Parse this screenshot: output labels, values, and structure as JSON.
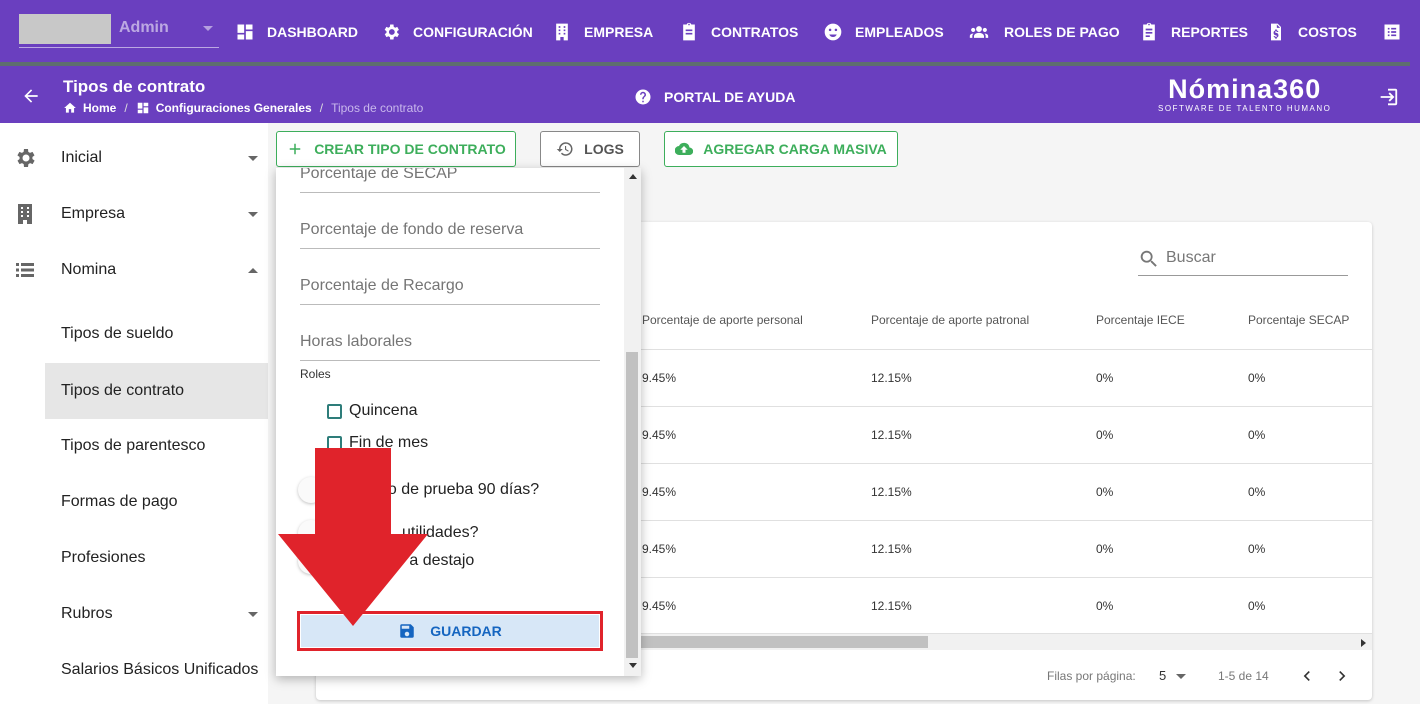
{
  "topnav": {
    "user": "Admin",
    "items": [
      {
        "label": "DASHBOARD",
        "icon": "dashboard-icon"
      },
      {
        "label": "CONFIGURACIÓN",
        "icon": "gear-icon"
      },
      {
        "label": "EMPRESA",
        "icon": "building-icon"
      },
      {
        "label": "CONTRATOS",
        "icon": "clipboard-icon"
      },
      {
        "label": "EMPLEADOS",
        "icon": "face-icon"
      },
      {
        "label": "ROLES DE PAGO",
        "icon": "group-icon"
      },
      {
        "label": "REPORTES",
        "icon": "clipboard-list-icon"
      },
      {
        "label": "COSTOS",
        "icon": "file-dollar-icon"
      }
    ]
  },
  "header": {
    "title": "Tipos de contrato",
    "breadcrumb": [
      "Home",
      "Configuraciones Generales",
      "Tipos de contrato"
    ],
    "help": "PORTAL DE AYUDA",
    "brand": "Nómina360",
    "brand_sub": "SOFTWARE DE TALENTO HUMANO"
  },
  "sidebar": {
    "items": [
      {
        "label": "Inicial"
      },
      {
        "label": "Empresa"
      },
      {
        "label": "Nomina"
      }
    ],
    "subitems": [
      {
        "label": "Tipos de sueldo"
      },
      {
        "label": "Tipos de contrato"
      },
      {
        "label": "Tipos de parentesco"
      },
      {
        "label": "Formas de pago"
      },
      {
        "label": "Profesiones"
      },
      {
        "label": "Rubros"
      },
      {
        "label": "Salarios Básicos Unificados"
      }
    ]
  },
  "toolbar": {
    "create": "CREAR TIPO DE CONTRATO",
    "logs": "LOGS",
    "bulk": "AGREGAR CARGA MASIVA"
  },
  "table": {
    "search_placeholder": "Buscar",
    "columns": [
      "Porcentaje de aporte personal",
      "Porcentaje de aporte patronal",
      "Porcentaje IECE",
      "Porcentaje SECAP"
    ],
    "rows": [
      [
        "9.45%",
        "12.15%",
        "0%",
        "0%"
      ],
      [
        "9.45%",
        "12.15%",
        "0%",
        "0%"
      ],
      [
        "9.45%",
        "12.15%",
        "0%",
        "0%"
      ],
      [
        "9.45%",
        "12.15%",
        "0%",
        "0%"
      ],
      [
        "9.45%",
        "12.15%",
        "0%",
        "0%"
      ]
    ],
    "rows_per_page_label": "Filas por página:",
    "rows_per_page": "5",
    "range": "1-5 de 14"
  },
  "dialog": {
    "fields": [
      "Porcentaje de SECAP",
      "Porcentaje de fondo de reserva",
      "Porcentaje de Recargo",
      "Horas laborales"
    ],
    "roles_label": "Roles",
    "roles": [
      "Quincena",
      "Fin de mes"
    ],
    "switches": [
      "do de prueba 90 días?",
      "utilidades?",
      "o a destajo"
    ],
    "save": "GUARDAR"
  },
  "colors": {
    "primary": "#6a3fbf",
    "green": "#3dae5b",
    "annotation": "#e0232b",
    "save_bg": "#d7e7f7"
  }
}
